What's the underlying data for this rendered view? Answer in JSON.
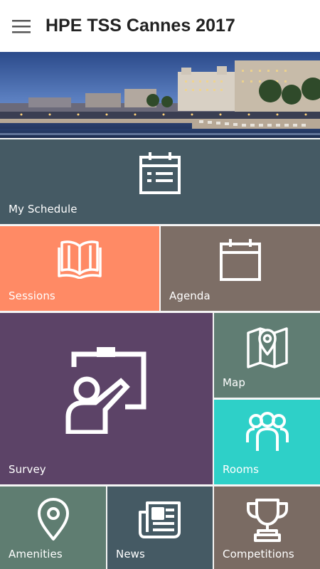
{
  "app": {
    "title": "HPE TSS Cannes 2017"
  },
  "colors": {
    "my_schedule": "#455a64",
    "sessions": "#ff8a65",
    "agenda": "#7d6e66",
    "survey": "#5c4367",
    "map": "#607d73",
    "rooms": "#2ed0c8",
    "amenities": "#5f7d71",
    "news": "#455a64",
    "competitions": "#7a6b63"
  },
  "tiles": {
    "my_schedule": {
      "label": "My Schedule",
      "icon": "schedule-icon"
    },
    "sessions": {
      "label": "Sessions",
      "icon": "book-icon"
    },
    "agenda": {
      "label": "Agenda",
      "icon": "calendar-icon"
    },
    "survey": {
      "label": "Survey",
      "icon": "presenter-board-icon"
    },
    "map": {
      "label": "Map",
      "icon": "map-pin-icon"
    },
    "rooms": {
      "label": "Rooms",
      "icon": "people-icon"
    },
    "amenities": {
      "label": "Amenities",
      "icon": "location-pin-icon"
    },
    "news": {
      "label": "News",
      "icon": "newspaper-icon"
    },
    "competitions": {
      "label": "Competitions",
      "icon": "trophy-icon"
    }
  }
}
